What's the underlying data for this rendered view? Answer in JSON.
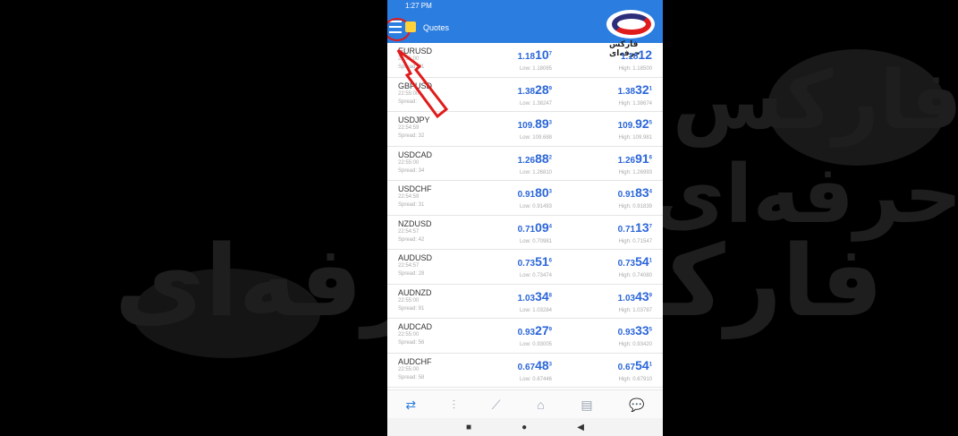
{
  "status_bar": {
    "time": "1:27 PM"
  },
  "app_bar": {
    "title": "Quotes"
  },
  "watermark": {
    "text": "فارکس حرفه‌ای"
  },
  "brand": {
    "name": "فارکس حرفه‌ای"
  },
  "quotes": [
    {
      "symbol": "EURUSD",
      "time": "22:55:00",
      "spread": "Spread: 21",
      "bid_main": "1.18",
      "bid_big": "10",
      "bid_sup": "7",
      "ask_main": "1.18",
      "ask_big": "12",
      "ask_sup": "",
      "low": "Low: 1.18085",
      "high": "High: 1.18500"
    },
    {
      "symbol": "GBPUSD",
      "time": "22:55:00",
      "spread": "Spread:",
      "bid_main": "1.38",
      "bid_big": "28",
      "bid_sup": "9",
      "ask_main": "1.38",
      "ask_big": "32",
      "ask_sup": "1",
      "low": "Low: 1.38247",
      "high": "High: 1.38674"
    },
    {
      "symbol": "USDJPY",
      "time": "22:54:59",
      "spread": "Spread: 32",
      "bid_main": "109.",
      "bid_big": "89",
      "bid_sup": "3",
      "ask_main": "109.",
      "ask_big": "92",
      "ask_sup": "5",
      "low": "Low: 109.688",
      "high": "High: 109.981"
    },
    {
      "symbol": "USDCAD",
      "time": "22:55:00",
      "spread": "Spread: 34",
      "bid_main": "1.26",
      "bid_big": "88",
      "bid_sup": "2",
      "ask_main": "1.26",
      "ask_big": "91",
      "ask_sup": "6",
      "low": "Low: 1.26810",
      "high": "High: 1.26993"
    },
    {
      "symbol": "USDCHF",
      "time": "22:54:59",
      "spread": "Spread: 31",
      "bid_main": "0.91",
      "bid_big": "80",
      "bid_sup": "3",
      "ask_main": "0.91",
      "ask_big": "83",
      "ask_sup": "4",
      "low": "Low: 0.91493",
      "high": "High: 0.91839"
    },
    {
      "symbol": "NZDUSD",
      "time": "22:54:57",
      "spread": "Spread: 42",
      "bid_main": "0.71",
      "bid_big": "09",
      "bid_sup": "4",
      "ask_main": "0.71",
      "ask_big": "13",
      "ask_sup": "7",
      "low": "Low: 0.70981",
      "high": "High: 0.71547"
    },
    {
      "symbol": "AUDUSD",
      "time": "22:54:57",
      "spread": "Spread: 28",
      "bid_main": "0.73",
      "bid_big": "51",
      "bid_sup": "6",
      "ask_main": "0.73",
      "ask_big": "54",
      "ask_sup": "1",
      "low": "Low: 0.73474",
      "high": "High: 0.74080"
    },
    {
      "symbol": "AUDNZD",
      "time": "22:55:00",
      "spread": "Spread: 91",
      "bid_main": "1.03",
      "bid_big": "34",
      "bid_sup": "8",
      "ask_main": "1.03",
      "ask_big": "43",
      "ask_sup": "9",
      "low": "Low: 1.03284",
      "high": "High: 1.03787"
    },
    {
      "symbol": "AUDCAD",
      "time": "22:55:00",
      "spread": "Spread: 56",
      "bid_main": "0.93",
      "bid_big": "27",
      "bid_sup": "9",
      "ask_main": "0.93",
      "ask_big": "33",
      "ask_sup": "5",
      "low": "Low: 0.93005",
      "high": "High: 0.93420"
    },
    {
      "symbol": "AUDCHF",
      "time": "22:55:00",
      "spread": "Spread: 58",
      "bid_main": "0.67",
      "bid_big": "48",
      "bid_sup": "3",
      "ask_main": "0.67",
      "ask_big": "54",
      "ask_sup": "1",
      "low": "Low: 0.67446",
      "high": "High: 0.67910"
    }
  ],
  "bottom_nav": [
    {
      "icon": "quotes-icon",
      "glyph": "⇄"
    },
    {
      "icon": "chart-icon",
      "glyph": "⫶"
    },
    {
      "icon": "trade-icon",
      "glyph": "⟋"
    },
    {
      "icon": "history-icon",
      "glyph": "⌂"
    },
    {
      "icon": "news-icon",
      "glyph": "▤"
    },
    {
      "icon": "messages-icon",
      "glyph": "💬"
    }
  ],
  "system_nav": [
    {
      "icon": "recent-apps-icon",
      "glyph": "■"
    },
    {
      "icon": "home-icon",
      "glyph": "●"
    },
    {
      "icon": "back-icon",
      "glyph": "◀"
    }
  ],
  "colors": {
    "accent": "#2b7de0",
    "price": "#2b66d8",
    "highlight": "#e01b1b"
  }
}
